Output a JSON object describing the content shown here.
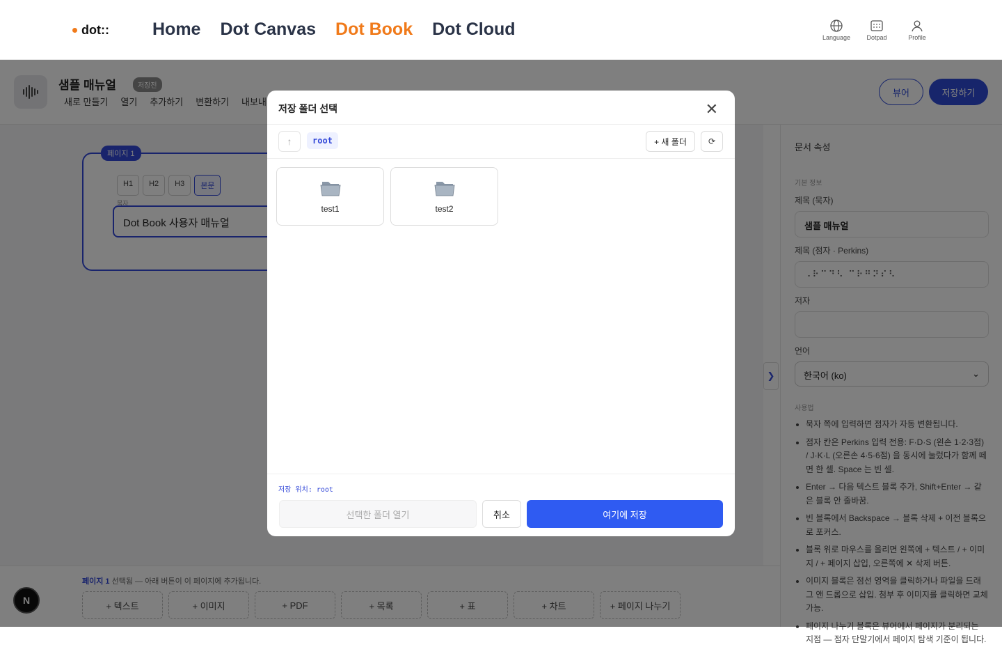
{
  "header": {
    "logo": "dot::",
    "nav": [
      "Home",
      "Dot Canvas",
      "Dot Book",
      "Dot Cloud"
    ],
    "active_nav": "Dot Book",
    "tools": [
      {
        "label": "Language",
        "icon": "globe-icon"
      },
      {
        "label": "Dotpad",
        "icon": "dotpad-icon"
      },
      {
        "label": "Profile",
        "icon": "user-icon"
      }
    ]
  },
  "toolbar": {
    "doc_title": "샘플 매뉴얼",
    "status_badge": "저장전",
    "menu": [
      "새로 만들기",
      "열기",
      "추가하기",
      "변환하기",
      "내보내기"
    ],
    "viewer_label": "뷰어",
    "save_label": "저장하기"
  },
  "editor": {
    "page_tag": "페이지 1",
    "heading_buttons": [
      "H1",
      "H2",
      "H3",
      "본문"
    ],
    "active_heading": "본문",
    "field_label": "묵자",
    "title_value": "Dot Book 사용자 매뉴얼"
  },
  "properties": {
    "title": "문서 속성",
    "section_basic": "기본 정보",
    "title_label": "제목 (묵자)",
    "title_value": "샘플 매뉴얼",
    "braille_label": "제목 (점자 · Perkins)",
    "braille_value": "⠠⠗⠉⠙⠣ ⠉⠗⠛⠝⠎⠣",
    "author_label": "저자",
    "author_value": "",
    "language_label": "언어",
    "language_value": "한국어 (ko)",
    "usage_label": "사용법",
    "usage": [
      "묵자 쪽에 입력하면 점자가 자동 변환됩니다.",
      "점자 칸은 Perkins 입력 전용: F·D·S (왼손 1·2·3점) / J·K·L (오른손 4·5·6점) 을 동시에 눌렀다가 함께 떼면 한 셀. Space 는 빈 셀.",
      "Enter → 다음 텍스트 블록 추가, Shift+Enter → 같은 블록 안 줄바꿈.",
      "빈 블록에서 Backspace → 블록 삭제 + 이전 블록으로 포커스.",
      "블록 위로 마우스를 올리면 왼쪽에 + 텍스트 / + 이미지 / + 페이지 삽입, 오른쪽에 ✕ 삭제 버튼.",
      "이미지 블록은 점선 영역을 클릭하거나 파일을 드래그 앤 드롭으로 삽입. 첨부 후 이미지를 클릭하면 교체 가능.",
      "페이지 나누기 블록은 뷰어에서 페이지가 분리되는 지점 — 점자 단말기에서 페이지 탐색 기준이 됩니다."
    ]
  },
  "bottom": {
    "selected_page": "페이지 1",
    "selected_info": "선택됨 — 아래 버튼이 이 페이지에 추가됩니다.",
    "add_buttons": [
      "+ 텍스트",
      "+ 이미지",
      "+ PDF",
      "+ 목록",
      "+ 표",
      "+ 차트",
      "+ 페이지 나누기"
    ]
  },
  "modal": {
    "title": "저장 폴더 선택",
    "path": "root",
    "new_folder_label": "+ 새 폴더",
    "refresh_label": "⟳",
    "folders": [
      "test1",
      "test2"
    ],
    "save_location": "저장 위치: root",
    "open_selected_label": "선택한 폴더 열기",
    "cancel_label": "취소",
    "save_here_label": "여기에 저장"
  },
  "floating_badge": "N",
  "colors": {
    "brand_orange": "#f07a1a",
    "primary_blue": "#2f4bd6",
    "save_blue": "#2f5bf2"
  }
}
